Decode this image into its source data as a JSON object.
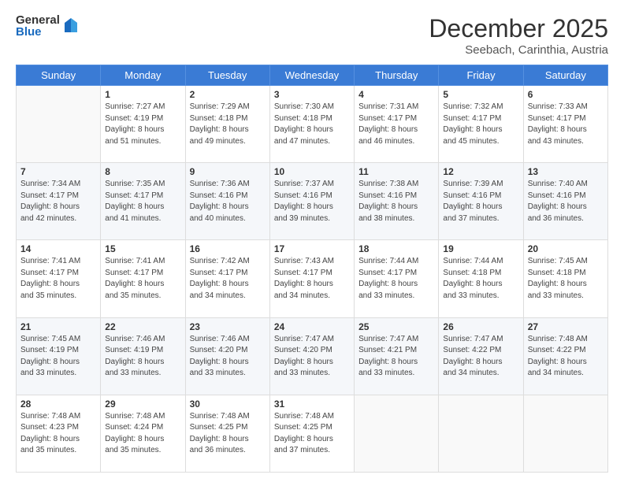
{
  "header": {
    "logo_general": "General",
    "logo_blue": "Blue",
    "month_year": "December 2025",
    "location": "Seebach, Carinthia, Austria"
  },
  "days_of_week": [
    "Sunday",
    "Monday",
    "Tuesday",
    "Wednesday",
    "Thursday",
    "Friday",
    "Saturday"
  ],
  "weeks": [
    [
      {
        "day": "",
        "info": ""
      },
      {
        "day": "1",
        "info": "Sunrise: 7:27 AM\nSunset: 4:19 PM\nDaylight: 8 hours\nand 51 minutes."
      },
      {
        "day": "2",
        "info": "Sunrise: 7:29 AM\nSunset: 4:18 PM\nDaylight: 8 hours\nand 49 minutes."
      },
      {
        "day": "3",
        "info": "Sunrise: 7:30 AM\nSunset: 4:18 PM\nDaylight: 8 hours\nand 47 minutes."
      },
      {
        "day": "4",
        "info": "Sunrise: 7:31 AM\nSunset: 4:17 PM\nDaylight: 8 hours\nand 46 minutes."
      },
      {
        "day": "5",
        "info": "Sunrise: 7:32 AM\nSunset: 4:17 PM\nDaylight: 8 hours\nand 45 minutes."
      },
      {
        "day": "6",
        "info": "Sunrise: 7:33 AM\nSunset: 4:17 PM\nDaylight: 8 hours\nand 43 minutes."
      }
    ],
    [
      {
        "day": "7",
        "info": "Sunrise: 7:34 AM\nSunset: 4:17 PM\nDaylight: 8 hours\nand 42 minutes."
      },
      {
        "day": "8",
        "info": "Sunrise: 7:35 AM\nSunset: 4:17 PM\nDaylight: 8 hours\nand 41 minutes."
      },
      {
        "day": "9",
        "info": "Sunrise: 7:36 AM\nSunset: 4:16 PM\nDaylight: 8 hours\nand 40 minutes."
      },
      {
        "day": "10",
        "info": "Sunrise: 7:37 AM\nSunset: 4:16 PM\nDaylight: 8 hours\nand 39 minutes."
      },
      {
        "day": "11",
        "info": "Sunrise: 7:38 AM\nSunset: 4:16 PM\nDaylight: 8 hours\nand 38 minutes."
      },
      {
        "day": "12",
        "info": "Sunrise: 7:39 AM\nSunset: 4:16 PM\nDaylight: 8 hours\nand 37 minutes."
      },
      {
        "day": "13",
        "info": "Sunrise: 7:40 AM\nSunset: 4:16 PM\nDaylight: 8 hours\nand 36 minutes."
      }
    ],
    [
      {
        "day": "14",
        "info": "Sunrise: 7:41 AM\nSunset: 4:17 PM\nDaylight: 8 hours\nand 35 minutes."
      },
      {
        "day": "15",
        "info": "Sunrise: 7:41 AM\nSunset: 4:17 PM\nDaylight: 8 hours\nand 35 minutes."
      },
      {
        "day": "16",
        "info": "Sunrise: 7:42 AM\nSunset: 4:17 PM\nDaylight: 8 hours\nand 34 minutes."
      },
      {
        "day": "17",
        "info": "Sunrise: 7:43 AM\nSunset: 4:17 PM\nDaylight: 8 hours\nand 34 minutes."
      },
      {
        "day": "18",
        "info": "Sunrise: 7:44 AM\nSunset: 4:17 PM\nDaylight: 8 hours\nand 33 minutes."
      },
      {
        "day": "19",
        "info": "Sunrise: 7:44 AM\nSunset: 4:18 PM\nDaylight: 8 hours\nand 33 minutes."
      },
      {
        "day": "20",
        "info": "Sunrise: 7:45 AM\nSunset: 4:18 PM\nDaylight: 8 hours\nand 33 minutes."
      }
    ],
    [
      {
        "day": "21",
        "info": "Sunrise: 7:45 AM\nSunset: 4:19 PM\nDaylight: 8 hours\nand 33 minutes."
      },
      {
        "day": "22",
        "info": "Sunrise: 7:46 AM\nSunset: 4:19 PM\nDaylight: 8 hours\nand 33 minutes."
      },
      {
        "day": "23",
        "info": "Sunrise: 7:46 AM\nSunset: 4:20 PM\nDaylight: 8 hours\nand 33 minutes."
      },
      {
        "day": "24",
        "info": "Sunrise: 7:47 AM\nSunset: 4:20 PM\nDaylight: 8 hours\nand 33 minutes."
      },
      {
        "day": "25",
        "info": "Sunrise: 7:47 AM\nSunset: 4:21 PM\nDaylight: 8 hours\nand 33 minutes."
      },
      {
        "day": "26",
        "info": "Sunrise: 7:47 AM\nSunset: 4:22 PM\nDaylight: 8 hours\nand 34 minutes."
      },
      {
        "day": "27",
        "info": "Sunrise: 7:48 AM\nSunset: 4:22 PM\nDaylight: 8 hours\nand 34 minutes."
      }
    ],
    [
      {
        "day": "28",
        "info": "Sunrise: 7:48 AM\nSunset: 4:23 PM\nDaylight: 8 hours\nand 35 minutes."
      },
      {
        "day": "29",
        "info": "Sunrise: 7:48 AM\nSunset: 4:24 PM\nDaylight: 8 hours\nand 35 minutes."
      },
      {
        "day": "30",
        "info": "Sunrise: 7:48 AM\nSunset: 4:25 PM\nDaylight: 8 hours\nand 36 minutes."
      },
      {
        "day": "31",
        "info": "Sunrise: 7:48 AM\nSunset: 4:25 PM\nDaylight: 8 hours\nand 37 minutes."
      },
      {
        "day": "",
        "info": ""
      },
      {
        "day": "",
        "info": ""
      },
      {
        "day": "",
        "info": ""
      }
    ]
  ]
}
